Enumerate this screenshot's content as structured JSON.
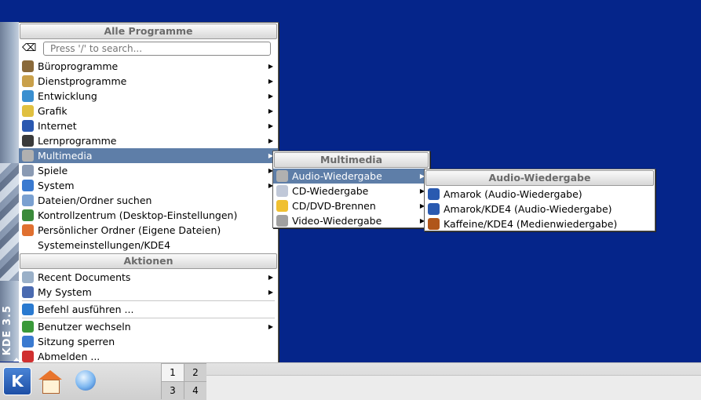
{
  "side_strip": {
    "label": "KDE 3.5"
  },
  "main_menu": {
    "header_programs": "Alle Programme",
    "search_placeholder": "Press '/' to search...",
    "program_items": [
      {
        "label": "Büroprogramme",
        "icon": "office-icon",
        "color": "#8a6a3a",
        "submenu": true
      },
      {
        "label": "Dienstprogramme",
        "icon": "utilities-icon",
        "color": "#c9a04a",
        "submenu": true
      },
      {
        "label": "Entwicklung",
        "icon": "development-icon",
        "color": "#3a8fd0",
        "submenu": true
      },
      {
        "label": "Grafik",
        "icon": "graphics-icon",
        "color": "#e0c040",
        "submenu": true
      },
      {
        "label": "Internet",
        "icon": "internet-icon",
        "color": "#2a58b0",
        "submenu": true
      },
      {
        "label": "Lernprogramme",
        "icon": "education-icon",
        "color": "#3a3a3a",
        "submenu": true
      },
      {
        "label": "Multimedia",
        "icon": "multimedia-icon",
        "color": "#b0b0b0",
        "submenu": true,
        "selected": true
      },
      {
        "label": "Spiele",
        "icon": "games-icon",
        "color": "#8a9ab3",
        "submenu": true
      },
      {
        "label": "System",
        "icon": "system-icon",
        "color": "#3a7ad0",
        "submenu": true
      }
    ],
    "direct_items": [
      {
        "label": "Dateien/Ordner suchen",
        "icon": "find-files-icon",
        "color": "#7aa0d0"
      },
      {
        "label": "Kontrollzentrum (Desktop-Einstellungen)",
        "icon": "control-center-icon",
        "color": "#3a8a3a"
      },
      {
        "label": "Persönlicher Ordner (Eigene Dateien)",
        "icon": "home-folder-icon",
        "color": "#e07030"
      },
      {
        "label": "Systemeinstellungen/KDE4",
        "icon": "",
        "color": ""
      }
    ],
    "header_actions": "Aktionen",
    "action_items": [
      {
        "label": "Recent Documents",
        "icon": "recent-documents-icon",
        "color": "#9ab0c8",
        "submenu": true
      },
      {
        "label": "My System",
        "icon": "my-system-icon",
        "color": "#4a6ab0",
        "submenu": true
      }
    ],
    "run_item": {
      "label": "Befehl ausführen ...",
      "icon": "run-command-icon",
      "color": "#2a7ad0"
    },
    "session_items": [
      {
        "label": "Benutzer wechseln",
        "icon": "switch-user-icon",
        "color": "#3a9a3a",
        "submenu": true
      },
      {
        "label": "Sitzung sperren",
        "icon": "lock-session-icon",
        "color": "#3a7ad0",
        "submenu": false
      },
      {
        "label": "Abmelden ...",
        "icon": "logout-icon",
        "color": "#d03030",
        "submenu": false
      }
    ]
  },
  "multimedia_menu": {
    "header": "Multimedia",
    "items": [
      {
        "label": "Audio-Wiedergabe",
        "icon": "audio-icon",
        "color": "#b0b0b0",
        "selected": true
      },
      {
        "label": "CD-Wiedergabe",
        "icon": "cd-player-icon",
        "color": "#c0c8d8",
        "selected": false
      },
      {
        "label": "CD/DVD-Brennen",
        "icon": "cd-burn-icon",
        "color": "#f0c030",
        "selected": false
      },
      {
        "label": "Video-Wiedergabe",
        "icon": "video-icon",
        "color": "#a0a0a0",
        "selected": false
      }
    ]
  },
  "audio_menu": {
    "header": "Audio-Wiedergabe",
    "items": [
      {
        "label": "Amarok (Audio-Wiedergabe)",
        "icon": "amarok-icon",
        "color": "#2a5ab0"
      },
      {
        "label": "Amarok/KDE4 (Audio-Wiedergabe)",
        "icon": "amarok-icon",
        "color": "#2a5ab0"
      },
      {
        "label": "Kaffeine/KDE4 (Medienwiedergabe)",
        "icon": "kaffeine-icon",
        "color": "#b0561a"
      }
    ]
  },
  "pager": {
    "desktops": [
      "1",
      "2",
      "3",
      "4"
    ],
    "active": "1"
  },
  "colors": {
    "desktop": "#05258a",
    "selection": "#5e7ea8"
  }
}
